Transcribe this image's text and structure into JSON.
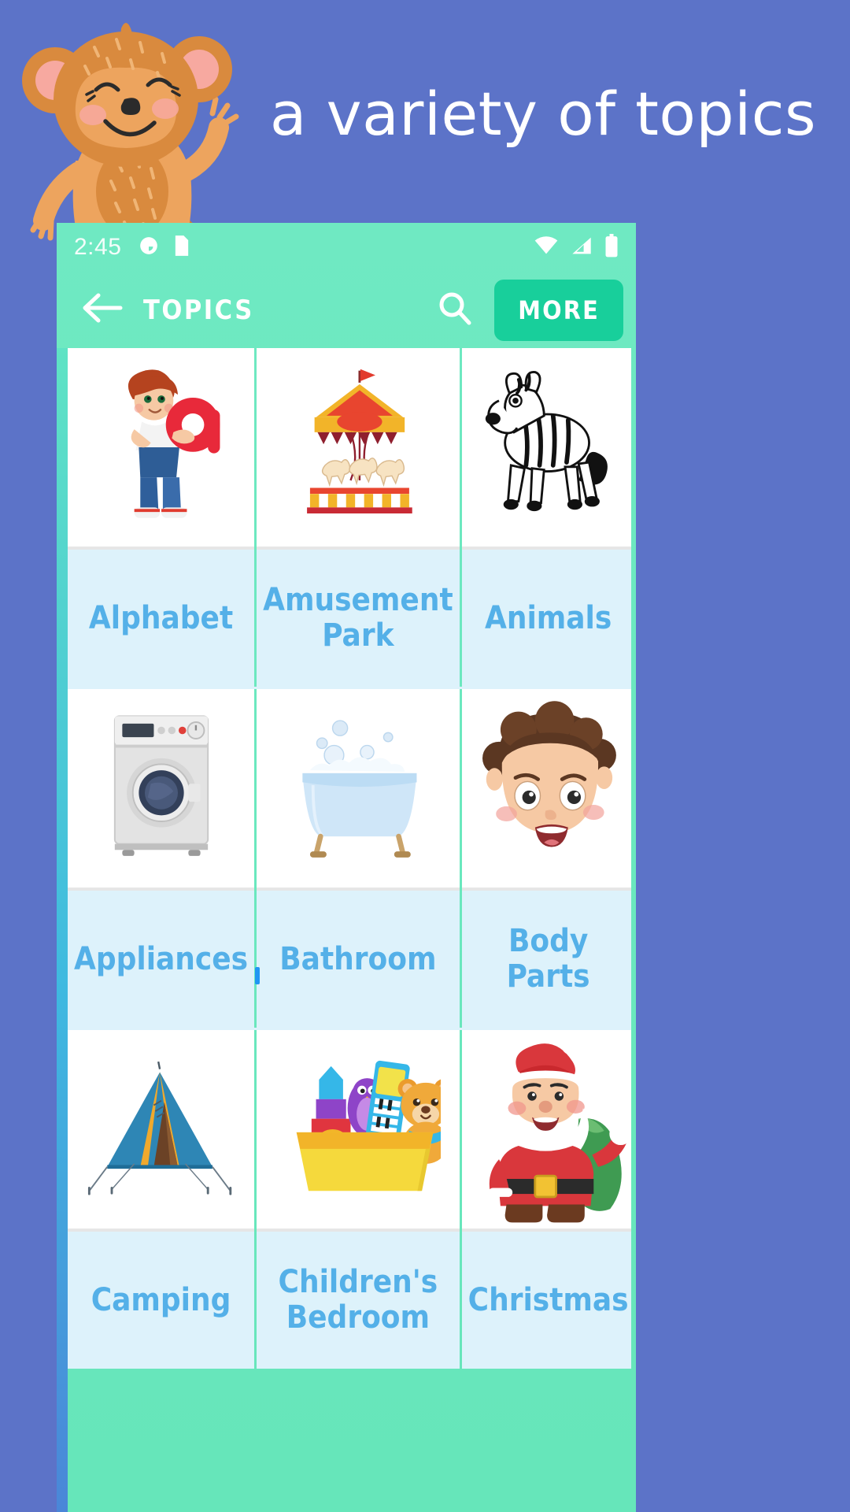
{
  "promo": {
    "headline": "a variety of topics",
    "background_color": "#5c73c8",
    "mascot": "monkey-mascot"
  },
  "device": {
    "statusbar": {
      "clock": "2:45",
      "left_icons": [
        "clock-icon",
        "document-icon"
      ],
      "right_icons": [
        "wifi-icon",
        "cellular-signal-icon",
        "battery-icon"
      ]
    },
    "toolbar": {
      "back_icon": "back-arrow-icon",
      "title": "TOPICS",
      "search_icon": "search-icon",
      "more_label": "MORE",
      "background_color": "#68e8bd",
      "more_button_color": "#18cf9b"
    },
    "grid": {
      "label_text_color": "#54b0e8",
      "label_band_color": "#ddf2fb",
      "rows": [
        [
          {
            "label": "Alphabet",
            "image": "boy-holding-letter-a"
          },
          {
            "label": "Amusement Park",
            "image": "carousel-merry-go-round"
          },
          {
            "label": "Animals",
            "image": "zebra"
          }
        ],
        [
          {
            "label": "Appliances",
            "image": "washing-machine"
          },
          {
            "label": "Bathroom",
            "image": "bathtub-with-bubbles"
          },
          {
            "label": "Body Parts",
            "image": "child-face"
          }
        ],
        [
          {
            "label": "Camping",
            "image": "camping-tent"
          },
          {
            "label": "Children's Bedroom",
            "image": "toy-box-with-teddy-bear"
          },
          {
            "label": "Christmas",
            "image": "santa-claus"
          }
        ]
      ]
    }
  }
}
